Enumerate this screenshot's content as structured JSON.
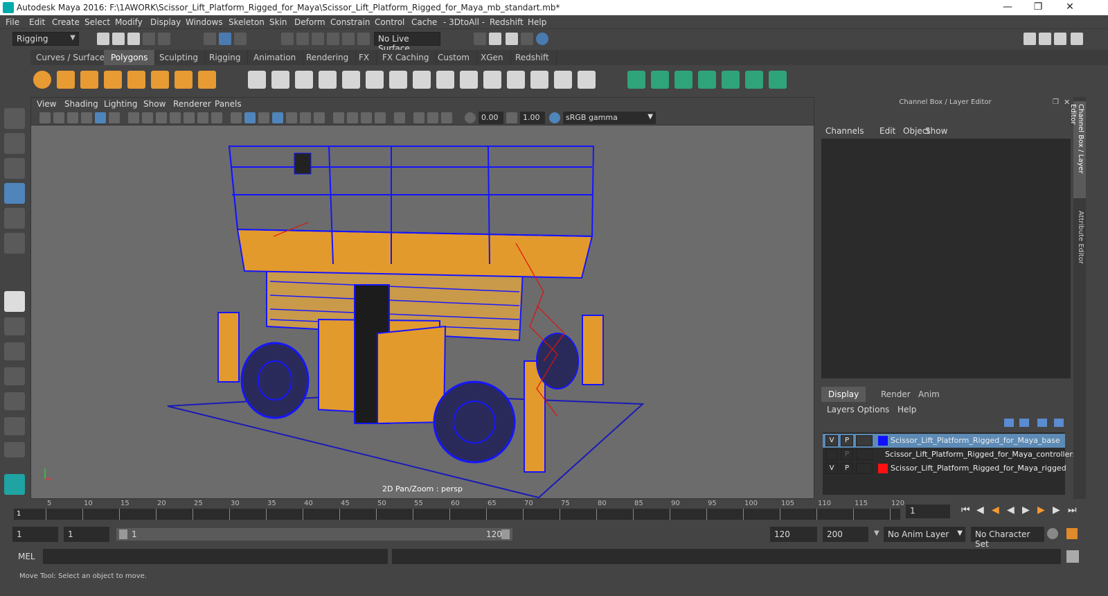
{
  "window": {
    "title": "Autodesk Maya 2016: F:\\1AWORK\\Scissor_Lift_Platform_Rigged_for_Maya\\Scissor_Lift_Platform_Rigged_for_Maya_mb_standart.mb*",
    "minimize_icon": "minimize-icon",
    "maximize_icon": "restore-icon",
    "close_icon": "close-icon"
  },
  "menu": [
    "File",
    "Edit",
    "Create",
    "Select",
    "Modify",
    "Display",
    "Windows",
    "Skeleton",
    "Skin",
    "Deform",
    "Constrain",
    "Control",
    "Cache",
    "- 3DtoAll -",
    "Redshift",
    "Help"
  ],
  "status_line": {
    "mode": "Rigging",
    "live_surface": "No Live Surface"
  },
  "shelf_tabs": [
    "Curves / Surfaces",
    "Polygons",
    "Sculpting",
    "Rigging",
    "Animation",
    "Rendering",
    "FX",
    "FX Caching",
    "Custom",
    "XGen",
    "Redshift"
  ],
  "shelf_tabs_active": "Polygons",
  "viewport": {
    "menu": [
      "View",
      "Shading",
      "Lighting",
      "Show",
      "Renderer",
      "Panels"
    ],
    "field_a": "0.00",
    "field_b": "1.00",
    "color_space": "sRGB gamma",
    "label": "2D Pan/Zoom : persp"
  },
  "channel_box": {
    "title": "Channel Box / Layer Editor",
    "menu": [
      "Channels",
      "Edit",
      "Object",
      "Show"
    ]
  },
  "layer_editor": {
    "tabs": [
      "Display",
      "Render",
      "Anim"
    ],
    "active_tab": "Display",
    "menu": [
      "Layers",
      "Options",
      "Help"
    ],
    "layers": [
      {
        "v": "V",
        "p": "P",
        "color": "#1010ff",
        "name": "Scissor_Lift_Platform_Rigged_for_Maya_base",
        "selected": true
      },
      {
        "v": "",
        "p": "P",
        "color": "",
        "name": "Scissor_Lift_Platform_Rigged_for_Maya_controllers",
        "selected": false
      },
      {
        "v": "V",
        "p": "P",
        "color": "#ff1010",
        "name": "Scissor_Lift_Platform_Rigged_for_Maya_rigged",
        "selected": false
      }
    ]
  },
  "side_tabs": [
    "Channel Box / Layer Editor",
    "Attribute Editor"
  ],
  "timeline": {
    "ticks": [
      "5",
      "10",
      "15",
      "20",
      "25",
      "30",
      "35",
      "40",
      "45",
      "50",
      "55",
      "60",
      "65",
      "70",
      "75",
      "80",
      "85",
      "90",
      "95",
      "100",
      "105",
      "110",
      "115",
      "120"
    ],
    "start_marker": "1",
    "current_frame": "1"
  },
  "range": {
    "start": "1",
    "playback_start": "1",
    "slider_start": "1",
    "slider_end": "120",
    "playback_end": "120",
    "end": "200",
    "anim_layer": "No Anim Layer",
    "character_set": "No Character Set"
  },
  "mel": {
    "label": "MEL"
  },
  "status": {
    "help_line": "Move Tool: Select an object to move."
  }
}
